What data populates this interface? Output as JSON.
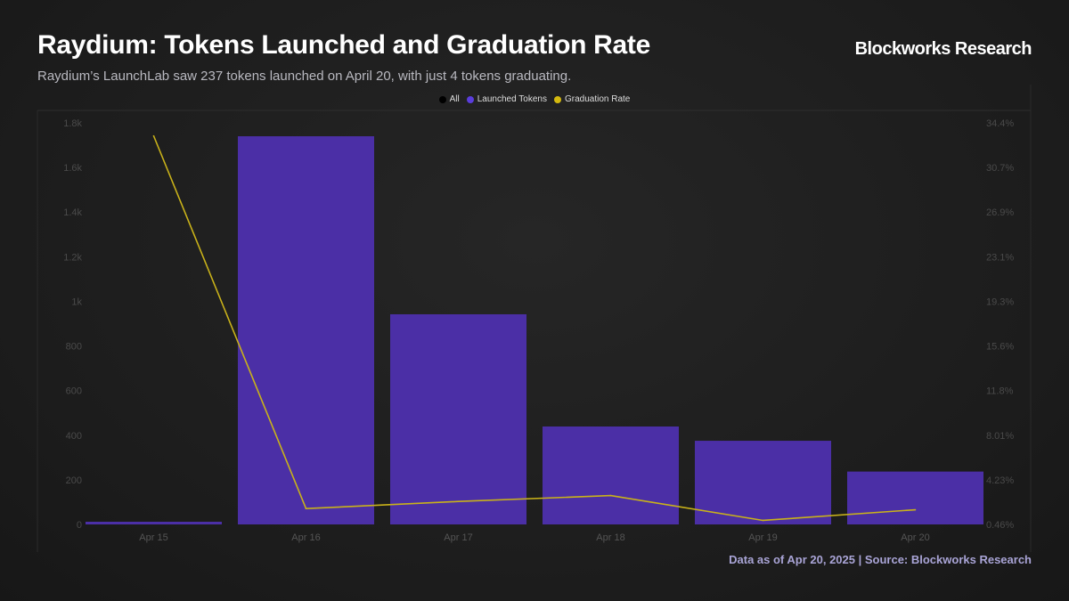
{
  "header": {
    "title": "Raydium: Tokens Launched and Graduation Rate",
    "brand": "Blockworks Research",
    "subtitle": "Raydium’s LaunchLab saw 237 tokens launched on April 20, with just 4 tokens graduating."
  },
  "footer": {
    "note": "Data as of Apr 20, 2025 | Source: Blockworks Research"
  },
  "chart_data": {
    "type": "bar+line",
    "categories": [
      "Apr 15",
      "Apr 16",
      "Apr 17",
      "Apr 18",
      "Apr 19",
      "Apr 20"
    ],
    "legend": [
      {
        "name": "All",
        "color": "#000000"
      },
      {
        "name": "Launched Tokens",
        "color": "#5a3ddc"
      },
      {
        "name": "Graduation Rate",
        "color": "#d4b90f"
      }
    ],
    "series": [
      {
        "name": "Launched Tokens",
        "type": "bar",
        "axis": "left",
        "color": "#4b2fa6",
        "values": [
          12,
          1740,
          942,
          439,
          375,
          237
        ]
      },
      {
        "name": "Graduation Rate",
        "type": "line",
        "axis": "right",
        "color": "#c9b21a",
        "values": [
          33.3,
          1.8,
          2.4,
          2.9,
          0.8,
          1.7
        ]
      }
    ],
    "left_axis": {
      "ylim": [
        0,
        1800
      ],
      "ticks": [
        0,
        200,
        400,
        600,
        800,
        1000,
        1200,
        1400,
        1600,
        1800
      ],
      "tick_labels": [
        "0",
        "200",
        "400",
        "600",
        "800",
        "1k",
        "1.2k",
        "1.4k",
        "1.6k",
        "1.8k"
      ]
    },
    "right_axis": {
      "ylim": [
        0.46,
        34.4
      ],
      "tick_labels": [
        "0.46%",
        "4.23%",
        "8.01%",
        "11.8%",
        "15.6%",
        "19.3%",
        "23.1%",
        "26.9%",
        "30.7%",
        "34.4%"
      ]
    },
    "legend_position": "top-center"
  }
}
